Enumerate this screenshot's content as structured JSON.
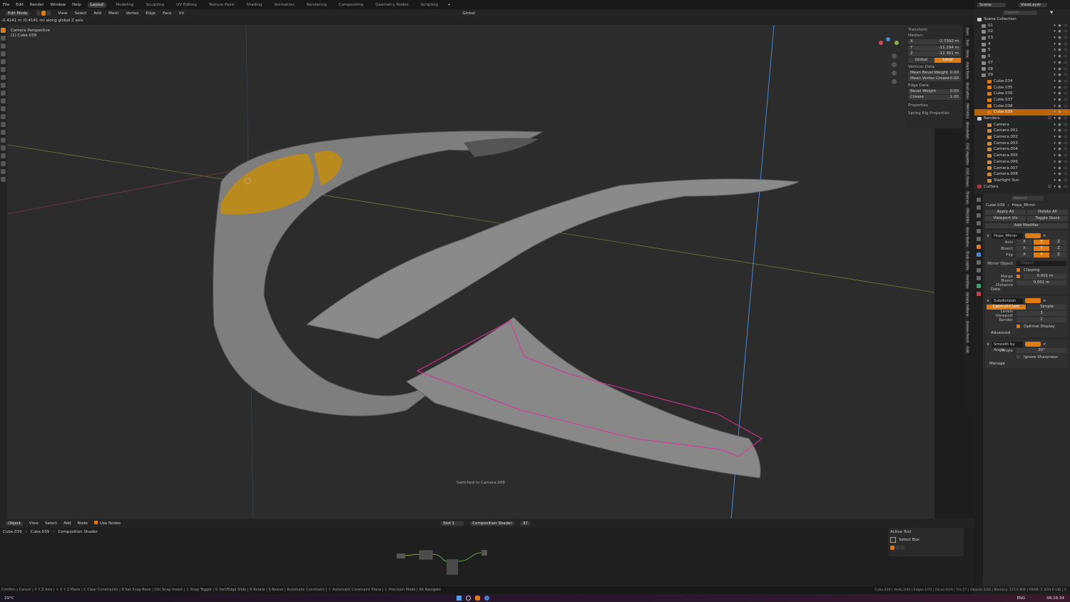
{
  "menu": {
    "items": [
      "File",
      "Edit",
      "Render",
      "Window",
      "Help"
    ],
    "workspaces": [
      "Layout",
      "Modeling",
      "Sculpting",
      "UV Editing",
      "Texture Paint",
      "Shading",
      "Animation",
      "Rendering",
      "Compositing",
      "Geometry Nodes",
      "Scripting"
    ],
    "active_workspace": "Layout",
    "add": "+"
  },
  "header": {
    "mode": "Edit Mode",
    "menus": [
      "View",
      "Select",
      "Add",
      "Mesh",
      "Vertex",
      "Edge",
      "Face",
      "UV"
    ],
    "orientation": "Global"
  },
  "operator_info": "-0.4141 m (0.4141 m) along global Z axis",
  "viewport": {
    "camera": "Camera Perspective",
    "object": "(1) Cube.039",
    "message": "Switched to Camera.008"
  },
  "npanel": {
    "title": "Transform",
    "median": "Median:",
    "fields": [
      {
        "label": "X",
        "value": "-2.7392 m"
      },
      {
        "label": "Y",
        "value": "-11.194 m"
      },
      {
        "label": "Z",
        "value": "-12.361 m"
      }
    ],
    "global": "Global",
    "local": "Local",
    "vertices_data": "Vertices Data:",
    "vfields": [
      {
        "label": "Mean Bevel Weight",
        "value": "0.00"
      },
      {
        "label": "Mean Vertex Crease",
        "value": "0.00"
      }
    ],
    "edge_data": "Edge Data:",
    "efields": [
      {
        "label": "Bevel Weight",
        "value": "0.00"
      },
      {
        "label": "Crease",
        "value": "1.00"
      }
    ],
    "properties": "Properties",
    "spring": "Spring Rig Properties"
  },
  "side_tabs": [
    "Item",
    "Tool",
    "View",
    "Hard Tools",
    "BoxCutter",
    "MACHIN3",
    "Blenderkit",
    "CGC Hypaths",
    "CGC Draws",
    "Themes",
    "MACHIN3",
    "Bone Baster",
    "Track Lights",
    "HardOps",
    "Simply Addons",
    "Grease Pencil",
    "Edit"
  ],
  "outliner": {
    "scene": "Scene",
    "view_layer": "ViewLayer",
    "search": "Search",
    "root": "Scene Collection",
    "collections": [
      "01",
      "02",
      "03",
      "4",
      "5",
      "6",
      "07",
      "08",
      "09"
    ],
    "objects": [
      "Cube.034",
      "Cube.035",
      "Cube.036",
      "Cube.037",
      "Cube.038",
      "Cube.039"
    ],
    "selected": "Cube.039",
    "renders": "Renders",
    "cameras": [
      "Camera",
      "Camera.001",
      "Camera.002",
      "Camera.003",
      "Camera.004",
      "Camera.005",
      "Camera.006",
      "Camera.007",
      "Camera.008",
      "Starlight Sun"
    ],
    "cutters": "Cutters"
  },
  "properties": {
    "search": "Search",
    "breadcrumb": [
      "Cube.039",
      "Hops_Mirror"
    ],
    "apply_all": "Apply All",
    "delete_all": "Delete All",
    "viewport_vis": "Viewport Vis",
    "toggle_stack": "Toggle Stack",
    "add_modifier": "Add Modifier",
    "mirror": {
      "name": "Hops_Mirror",
      "axis": "Axis",
      "bisect": "Bisect",
      "flip": "Flip",
      "xyz": [
        "X",
        "Y",
        "Z"
      ],
      "mirror_object": "Mirror Object",
      "object_placeholder": "Object",
      "clipping": "Clipping",
      "merge": "Merge",
      "merge_value": "0.001 m",
      "bisect_distance": "Bisect Distance",
      "bisect_value": "0.001 m",
      "data": "Data"
    },
    "subdivision": {
      "name": "Subdivision",
      "catmull": "Catmull-Clark",
      "simple": "Simple",
      "levels_viewport": "Levels Viewport",
      "levels_value": "3",
      "render": "Render",
      "render_value": "2",
      "optimal": "Optimal Display",
      "advanced": "Advanced"
    },
    "smooth": {
      "name": "Smooth by Angle",
      "angle": "Angle",
      "angle_value": "30°",
      "ignore": "Ignore Sharpness",
      "manage": "Manage"
    }
  },
  "node_editor": {
    "type": "Object",
    "menus": [
      "View",
      "Select",
      "Add",
      "Node"
    ],
    "use_nodes": "Use Nodes",
    "slot": "Slot 1",
    "material": "Composition Shader",
    "users": "37",
    "breadcrumb": [
      "Cube.039",
      "Cube.039",
      "Composition Shader"
    ]
  },
  "active_tool": {
    "title": "Active Tool",
    "tool": "Select Box"
  },
  "status": {
    "hints": "Confirm  |  Cancel  |  X Y Z Axis  |  ⇧ X Y Z Plane  |  C Clear Constraints  |  B Set Snap Base  |  Ctrl Snap Invert  |  ⇧ Snap Toggle  |  G Vert/Edge Slide  |  R Rotate  |  S Resize  |  Automatic Constraint  |  ⇧ Automatic Constraint Plane  |  ⇧ Precision Mode  |  Alt Navigate",
    "stats": "Cube.039 | Verts:2/43 | Edges:1/72 | Faces:0/29 | Tris:57 | Objects:1/16 | Memory: 125.0 MiB | VRAM: 5.3/24.0 GiB | 4.",
    "weather": "29°C",
    "lang": "ENG",
    "time": "08:28:34"
  },
  "colors": {
    "accent": "#e07b12",
    "selected_edge": "#e0309a",
    "y_axis": "#8ab04a",
    "x_axis": "#b04050",
    "z_axis": "#4a88d0"
  }
}
